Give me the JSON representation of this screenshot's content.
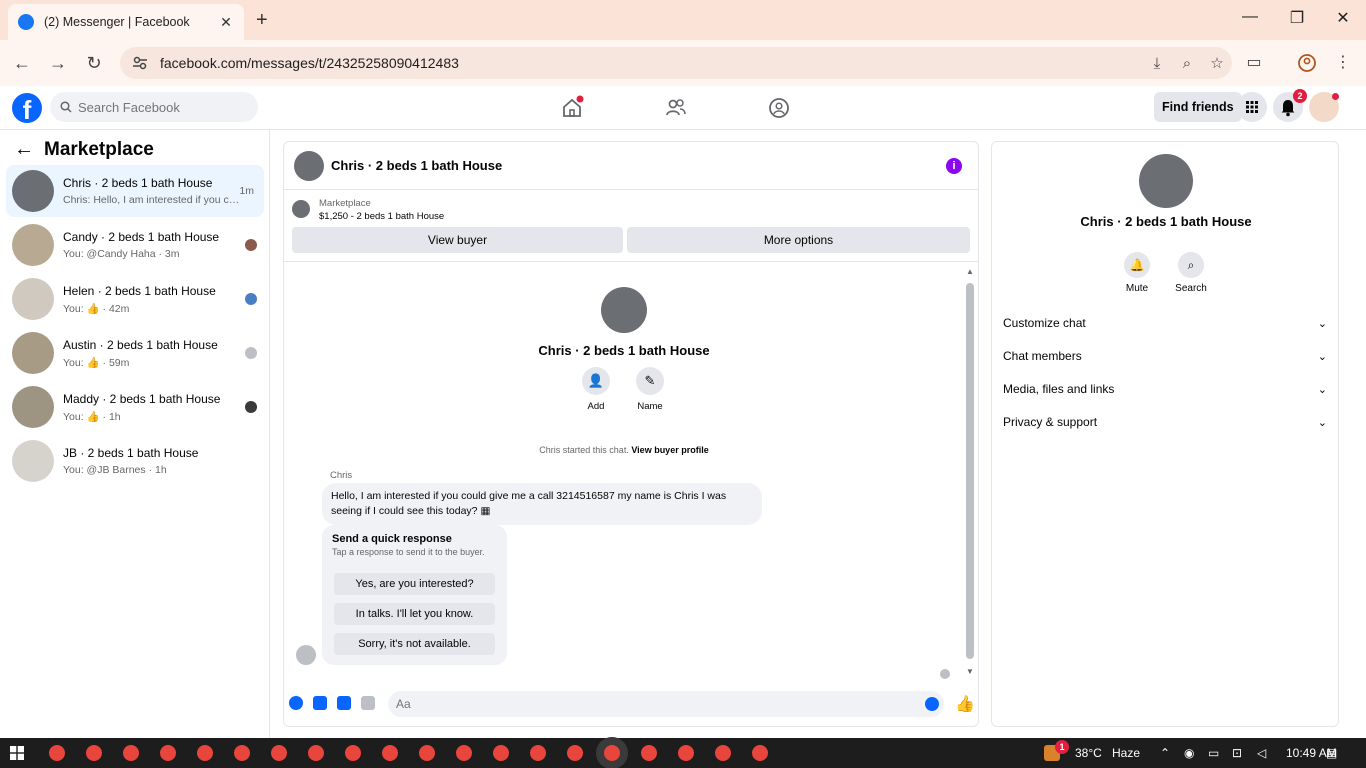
{
  "browser": {
    "tab_title": "(2) Messenger | Facebook",
    "url": "facebook.com/messages/t/24325258090412483"
  },
  "fb": {
    "search_placeholder": "Search Facebook",
    "find_friends": "Find friends",
    "notification_count": "2"
  },
  "left": {
    "title": "Marketplace",
    "conversations": [
      {
        "name": "Chris · 2 beds 1 bath House",
        "preview": "Chris: Hello, I am interested if you co...",
        "time": "1m",
        "active": true
      },
      {
        "name": "Candy · 2 beds 1 bath House",
        "preview": "You: @Candy Haha · 3m",
        "time": "",
        "active": false
      },
      {
        "name": "Helen · 2 beds 1 bath House",
        "preview": "You: 👍 · 42m",
        "time": "",
        "active": false
      },
      {
        "name": "Austin · 2 beds 1 bath House",
        "preview": "You: 👍 · 59m",
        "time": "",
        "active": false
      },
      {
        "name": "Maddy · 2 beds 1 bath House",
        "preview": "You: 👍 · 1h",
        "time": "",
        "active": false
      },
      {
        "name": "JB · 2 beds 1 bath House",
        "preview": "You: @JB Barnes · 1h",
        "time": "",
        "active": false
      }
    ]
  },
  "chat": {
    "title": "Chris · 2 beds 1 bath House",
    "listing_label": "Marketplace",
    "listing_price": "$1,250 - 2 beds 1 bath House",
    "view_buyer": "View buyer",
    "more_options": "More options",
    "profile_name": "Chris · 2 beds 1 bath House",
    "add_label": "Add",
    "name_label": "Name",
    "started_text": "Chris started this chat.",
    "view_buyer_profile": "View buyer profile",
    "sender": "Chris",
    "message": "Hello, I am interested if you could give me a call  3214516587 my name is Chris I was seeing if I could see this today? ",
    "quick_title": "Send a quick response",
    "quick_sub": "Tap a response to send it to the buyer.",
    "quick_replies": [
      "Yes, are you interested?",
      "In talks. I'll let you know.",
      "Sorry, it's not available."
    ],
    "input_placeholder": "Aa"
  },
  "right": {
    "name": "Chris · 2 beds 1 bath House",
    "mute": "Mute",
    "search": "Search",
    "sections": [
      "Customize chat",
      "Chat members",
      "Media, files and links",
      "Privacy & support"
    ]
  },
  "taskbar": {
    "temperature": "38°C",
    "weather": "Haze",
    "time": "10:49 AM",
    "weather_badge": "1"
  },
  "colors": {
    "accent": "#0866ff",
    "info": "#8a07f0",
    "tabbar": "#fbe3d8"
  }
}
